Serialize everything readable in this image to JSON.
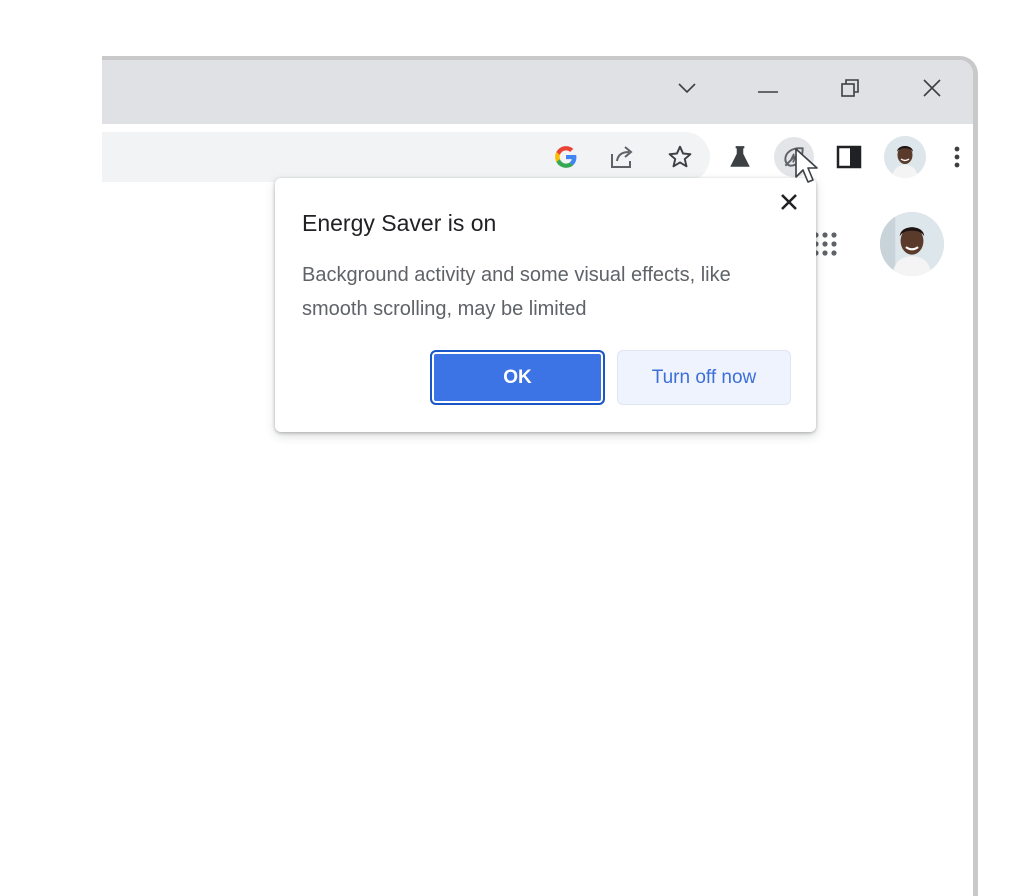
{
  "window": {
    "controls": {
      "tab_search_icon": "chevron-down-icon",
      "minimize_icon": "minimize-icon",
      "restore_icon": "restore-icon",
      "close_icon": "close-icon"
    }
  },
  "toolbar": {
    "icons": [
      "google-g-icon",
      "share-icon",
      "bookmark-star-icon",
      "labs-flask-icon",
      "energy-saver-leaf-icon",
      "side-panel-icon",
      "profile-avatar",
      "more-menu-icon"
    ]
  },
  "page": {
    "icons": [
      "apps-grid-icon",
      "account-avatar"
    ]
  },
  "bubble": {
    "title": "Energy Saver is on",
    "body": "Background activity and some visual effects, like smooth scrolling, may be limited",
    "ok_label": "OK",
    "turn_off_label": "Turn off now"
  },
  "colors": {
    "primary_button": "#3c73e5",
    "secondary_button_bg": "#eff3fd",
    "secondary_button_text": "#3d6fd8",
    "titlebar": "#dfe1e5"
  }
}
